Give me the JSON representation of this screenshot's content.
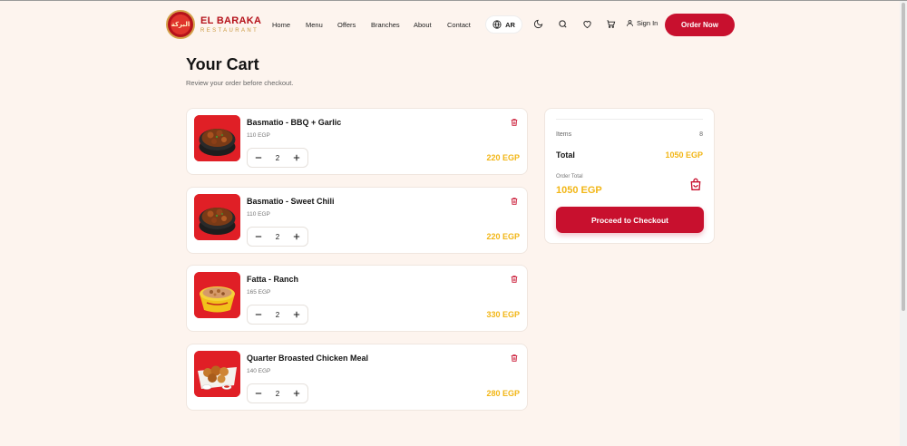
{
  "brand": {
    "name": "EL BARAKA",
    "tagline": "RESTAURANT",
    "logo_text": "البركة",
    "primary_color": "#c8102e",
    "accent_color": "#f2b616",
    "background_color": "#fdf4ee"
  },
  "nav": {
    "items": [
      "Home",
      "Menu",
      "Offers",
      "Branches",
      "About",
      "Contact"
    ],
    "language_label": "AR",
    "language_icon": "globe-icon",
    "icons": [
      "moon-icon",
      "search-icon",
      "heart-icon",
      "cart-icon"
    ],
    "signin_label": "Sign In",
    "order_now_label": "Order Now"
  },
  "page": {
    "title": "Your Cart",
    "subtitle": "Review your order before checkout."
  },
  "cart": {
    "items": [
      {
        "name": "Basmatio - BBQ + Garlic",
        "unit_price": "110 EGP",
        "quantity": "2",
        "total": "220 EGP",
        "image": "rice-bowl-image"
      },
      {
        "name": "Basmatio - Sweet Chili",
        "unit_price": "110 EGP",
        "quantity": "2",
        "total": "220 EGP",
        "image": "rice-bowl-image"
      },
      {
        "name": "Fatta - Ranch",
        "unit_price": "165 EGP",
        "quantity": "2",
        "total": "330 EGP",
        "image": "fatta-bowl-image"
      },
      {
        "name": "Quarter Broasted Chicken Meal",
        "unit_price": "140 EGP",
        "quantity": "2",
        "total": "280 EGP",
        "image": "chicken-meal-image"
      }
    ]
  },
  "summary": {
    "items_label": "Items",
    "items_count": "8",
    "total_label": "Total",
    "total_value": "1050 EGP",
    "order_total_label": "Order Total",
    "order_total_value": "1050 EGP",
    "checkout_label": "Proceed to Checkout"
  }
}
